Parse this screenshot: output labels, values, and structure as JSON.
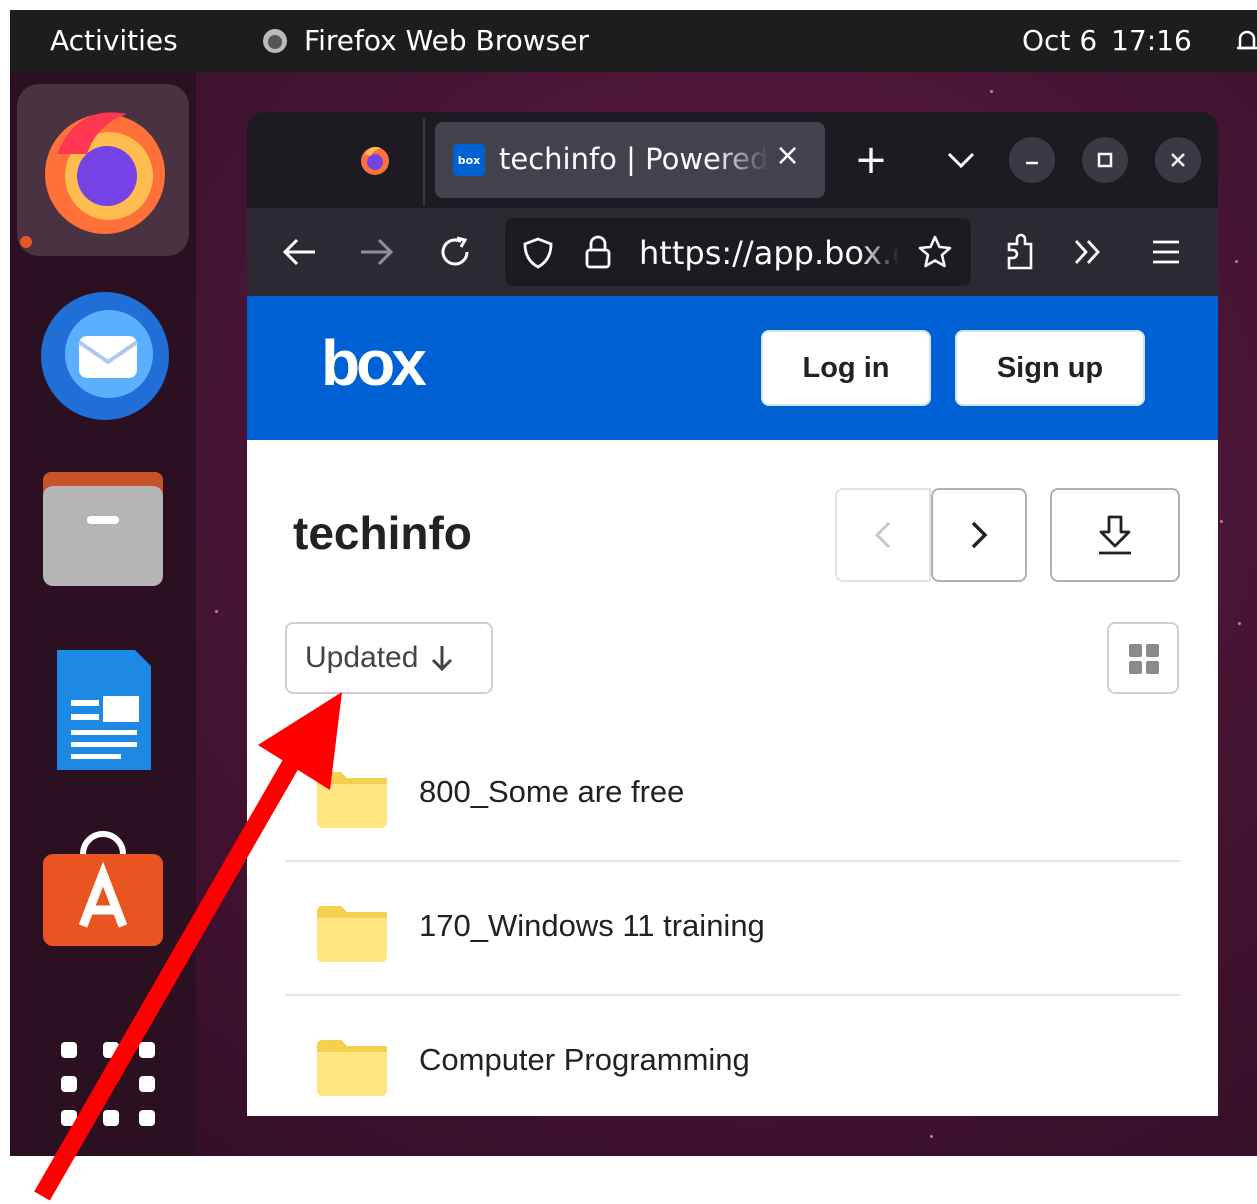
{
  "topbar": {
    "activities": "Activities",
    "app_name": "Firefox Web Browser",
    "date": "Oct 6",
    "time": "17:16"
  },
  "dock": {
    "apps": [
      "firefox-icon",
      "thunderbird-icon",
      "files-icon",
      "writer-icon",
      "software-icon",
      "app-grid-icon"
    ]
  },
  "browser": {
    "tab_title": "techinfo | Powered by Box",
    "tab_favicon_text": "box",
    "url": "https://app.box.com",
    "new_tab": "+",
    "tab_close": "×"
  },
  "page": {
    "logo": "box",
    "login": "Log in",
    "signup": "Sign up",
    "folder_title": "techinfo",
    "sort_label": "Updated",
    "items": [
      {
        "name": "800_Some are free"
      },
      {
        "name": "170_Windows 11 training"
      },
      {
        "name": "Computer Programming"
      }
    ]
  },
  "colors": {
    "box_blue": "#0061d5",
    "folder_yellow": "#fde580",
    "annotation_red": "#ff0000",
    "ubuntu_orange": "#e95420"
  }
}
